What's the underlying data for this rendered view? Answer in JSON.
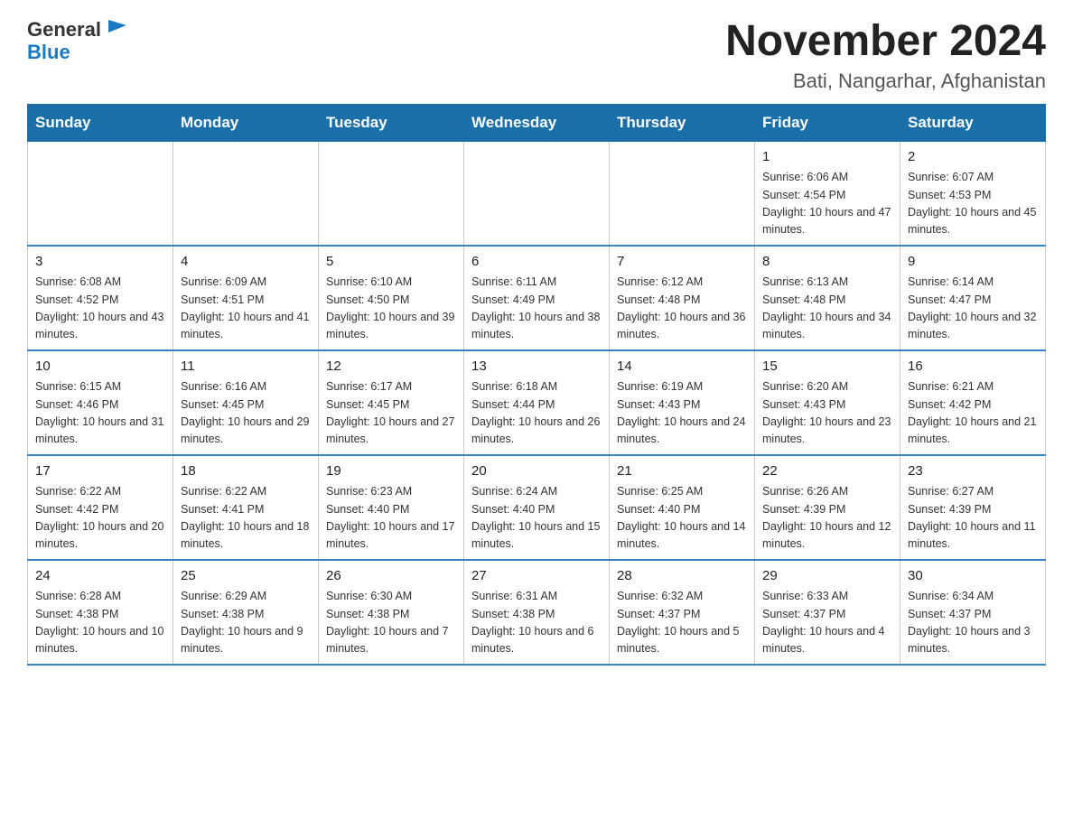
{
  "logo": {
    "text_general": "General",
    "text_blue": "Blue"
  },
  "header": {
    "title": "November 2024",
    "subtitle": "Bati, Nangarhar, Afghanistan"
  },
  "weekdays": [
    "Sunday",
    "Monday",
    "Tuesday",
    "Wednesday",
    "Thursday",
    "Friday",
    "Saturday"
  ],
  "weeks": [
    [
      {
        "day": "",
        "info": ""
      },
      {
        "day": "",
        "info": ""
      },
      {
        "day": "",
        "info": ""
      },
      {
        "day": "",
        "info": ""
      },
      {
        "day": "",
        "info": ""
      },
      {
        "day": "1",
        "info": "Sunrise: 6:06 AM\nSunset: 4:54 PM\nDaylight: 10 hours and 47 minutes."
      },
      {
        "day": "2",
        "info": "Sunrise: 6:07 AM\nSunset: 4:53 PM\nDaylight: 10 hours and 45 minutes."
      }
    ],
    [
      {
        "day": "3",
        "info": "Sunrise: 6:08 AM\nSunset: 4:52 PM\nDaylight: 10 hours and 43 minutes."
      },
      {
        "day": "4",
        "info": "Sunrise: 6:09 AM\nSunset: 4:51 PM\nDaylight: 10 hours and 41 minutes."
      },
      {
        "day": "5",
        "info": "Sunrise: 6:10 AM\nSunset: 4:50 PM\nDaylight: 10 hours and 39 minutes."
      },
      {
        "day": "6",
        "info": "Sunrise: 6:11 AM\nSunset: 4:49 PM\nDaylight: 10 hours and 38 minutes."
      },
      {
        "day": "7",
        "info": "Sunrise: 6:12 AM\nSunset: 4:48 PM\nDaylight: 10 hours and 36 minutes."
      },
      {
        "day": "8",
        "info": "Sunrise: 6:13 AM\nSunset: 4:48 PM\nDaylight: 10 hours and 34 minutes."
      },
      {
        "day": "9",
        "info": "Sunrise: 6:14 AM\nSunset: 4:47 PM\nDaylight: 10 hours and 32 minutes."
      }
    ],
    [
      {
        "day": "10",
        "info": "Sunrise: 6:15 AM\nSunset: 4:46 PM\nDaylight: 10 hours and 31 minutes."
      },
      {
        "day": "11",
        "info": "Sunrise: 6:16 AM\nSunset: 4:45 PM\nDaylight: 10 hours and 29 minutes."
      },
      {
        "day": "12",
        "info": "Sunrise: 6:17 AM\nSunset: 4:45 PM\nDaylight: 10 hours and 27 minutes."
      },
      {
        "day": "13",
        "info": "Sunrise: 6:18 AM\nSunset: 4:44 PM\nDaylight: 10 hours and 26 minutes."
      },
      {
        "day": "14",
        "info": "Sunrise: 6:19 AM\nSunset: 4:43 PM\nDaylight: 10 hours and 24 minutes."
      },
      {
        "day": "15",
        "info": "Sunrise: 6:20 AM\nSunset: 4:43 PM\nDaylight: 10 hours and 23 minutes."
      },
      {
        "day": "16",
        "info": "Sunrise: 6:21 AM\nSunset: 4:42 PM\nDaylight: 10 hours and 21 minutes."
      }
    ],
    [
      {
        "day": "17",
        "info": "Sunrise: 6:22 AM\nSunset: 4:42 PM\nDaylight: 10 hours and 20 minutes."
      },
      {
        "day": "18",
        "info": "Sunrise: 6:22 AM\nSunset: 4:41 PM\nDaylight: 10 hours and 18 minutes."
      },
      {
        "day": "19",
        "info": "Sunrise: 6:23 AM\nSunset: 4:40 PM\nDaylight: 10 hours and 17 minutes."
      },
      {
        "day": "20",
        "info": "Sunrise: 6:24 AM\nSunset: 4:40 PM\nDaylight: 10 hours and 15 minutes."
      },
      {
        "day": "21",
        "info": "Sunrise: 6:25 AM\nSunset: 4:40 PM\nDaylight: 10 hours and 14 minutes."
      },
      {
        "day": "22",
        "info": "Sunrise: 6:26 AM\nSunset: 4:39 PM\nDaylight: 10 hours and 12 minutes."
      },
      {
        "day": "23",
        "info": "Sunrise: 6:27 AM\nSunset: 4:39 PM\nDaylight: 10 hours and 11 minutes."
      }
    ],
    [
      {
        "day": "24",
        "info": "Sunrise: 6:28 AM\nSunset: 4:38 PM\nDaylight: 10 hours and 10 minutes."
      },
      {
        "day": "25",
        "info": "Sunrise: 6:29 AM\nSunset: 4:38 PM\nDaylight: 10 hours and 9 minutes."
      },
      {
        "day": "26",
        "info": "Sunrise: 6:30 AM\nSunset: 4:38 PM\nDaylight: 10 hours and 7 minutes."
      },
      {
        "day": "27",
        "info": "Sunrise: 6:31 AM\nSunset: 4:38 PM\nDaylight: 10 hours and 6 minutes."
      },
      {
        "day": "28",
        "info": "Sunrise: 6:32 AM\nSunset: 4:37 PM\nDaylight: 10 hours and 5 minutes."
      },
      {
        "day": "29",
        "info": "Sunrise: 6:33 AM\nSunset: 4:37 PM\nDaylight: 10 hours and 4 minutes."
      },
      {
        "day": "30",
        "info": "Sunrise: 6:34 AM\nSunset: 4:37 PM\nDaylight: 10 hours and 3 minutes."
      }
    ]
  ]
}
